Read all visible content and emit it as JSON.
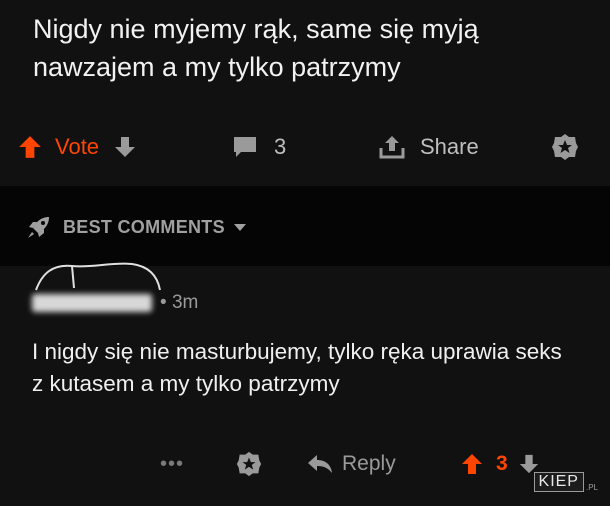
{
  "post": {
    "title": "Nigdy nie myjemy rąk, same się myją nawzajem a my tylko patrzymy",
    "vote_label": "Vote",
    "comment_count": "3",
    "share_label": "Share"
  },
  "comments_header": {
    "label": "BEST COMMENTS"
  },
  "comment": {
    "time": "3m",
    "body": "I nigdy się nie masturbujemy, tylko ręka uprawia seks z kutasem a my tylko patrzymy",
    "more_label": "•••",
    "reply_label": "Reply",
    "score": "3"
  },
  "watermark": {
    "text": "KIEP",
    "suffix": ".PL"
  },
  "colors": {
    "upvote": "#ff4500",
    "text": "#f0f0f0",
    "muted": "#9a9a9a",
    "background": "#111111"
  },
  "icons": [
    "upvote-arrow-icon",
    "downvote-arrow-icon",
    "comment-bubble-icon",
    "share-icon",
    "award-icon",
    "rocket-icon",
    "chevron-down-icon",
    "reply-arrow-icon"
  ]
}
